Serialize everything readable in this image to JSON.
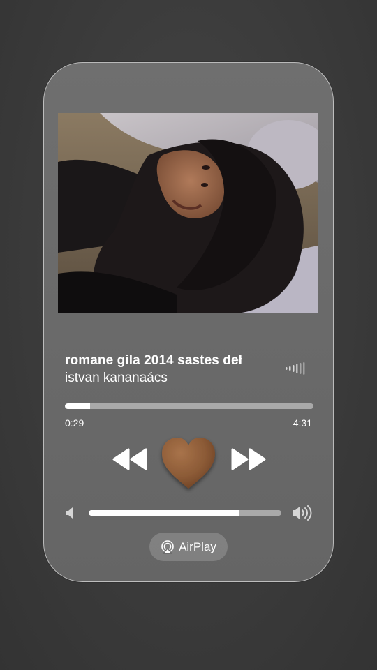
{
  "track": {
    "title": "romane gila 2014 sastes deł",
    "artist": "istvan kananaács"
  },
  "playback": {
    "elapsed": "0:29",
    "remaining": "–4:31",
    "progress_fraction": 0.1
  },
  "volume": {
    "level_fraction": 0.78
  },
  "controls": {
    "rewind_icon": "rewind-icon",
    "center_icon": "brown-heart-icon",
    "forward_icon": "fast-forward-icon",
    "airplay_label": "AirPlay"
  },
  "colors": {
    "card_background": "#6c6c6c",
    "track_fill": "#ffffff",
    "track_empty": "#a9a9a9",
    "heart": "#8b5a36"
  }
}
